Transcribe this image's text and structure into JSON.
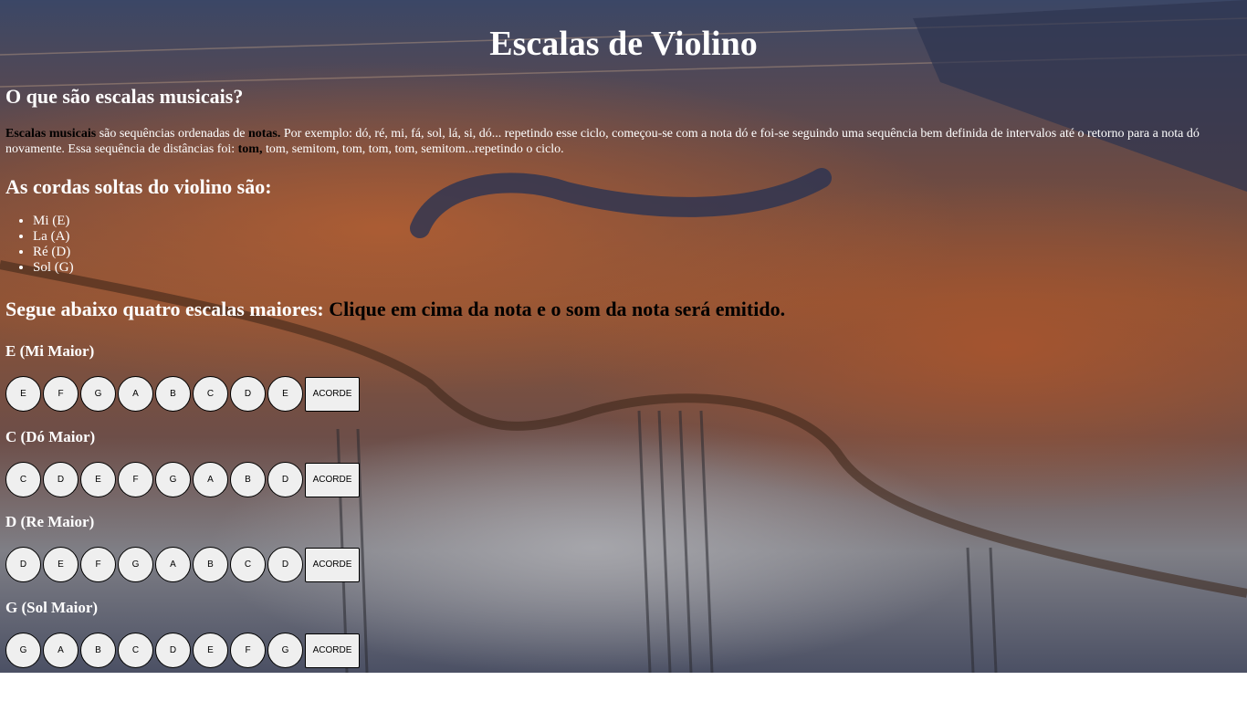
{
  "page": {
    "title": "Escalas de Violino"
  },
  "intro": {
    "heading": "O que são escalas musicais?",
    "term1": "Escalas musicais",
    "text1": " são sequências ordenadas de ",
    "term2": "notas.",
    "text2": " Por exemplo: dó, ré, mi, fá, sol, lá, si, dó... repetindo esse ciclo, começou-se com a nota dó e foi-se seguindo uma sequência bem definida de intervalos até o retorno para a nota dó novamente. Essa sequência de distâncias foi: ",
    "term3": "tom,",
    "text3": " tom, semitom, tom, tom, tom, semitom...repetindo o ciclo."
  },
  "strings": {
    "heading": "As cordas soltas do violino são:",
    "items": [
      "Mi (E)",
      "La (A)",
      "Ré (D)",
      "Sol (G)"
    ]
  },
  "scales_section": {
    "heading": "Segue abaixo quatro escalas maiores:",
    "instruction": " Clique em cima da nota e o som da nota será emitido."
  },
  "scales": [
    {
      "title": "E (Mi Maior)",
      "notes": [
        "E",
        "F",
        "G",
        "A",
        "B",
        "C",
        "D",
        "E"
      ],
      "chord_label": "ACORDE"
    },
    {
      "title": "C (Dó Maior)",
      "notes": [
        "C",
        "D",
        "E",
        "F",
        "G",
        "A",
        "B",
        "D"
      ],
      "chord_label": "ACORDE"
    },
    {
      "title": "D (Re Maior)",
      "notes": [
        "D",
        "E",
        "F",
        "G",
        "A",
        "B",
        "C",
        "D"
      ],
      "chord_label": "ACORDE"
    },
    {
      "title": "G (Sol Maior)",
      "notes": [
        "G",
        "A",
        "B",
        "C",
        "D",
        "E",
        "F",
        "G"
      ],
      "chord_label": "ACORDE"
    }
  ],
  "colors": {
    "text": "#ffffff",
    "emphasis": "#000000",
    "button_bg": "#efefef"
  }
}
